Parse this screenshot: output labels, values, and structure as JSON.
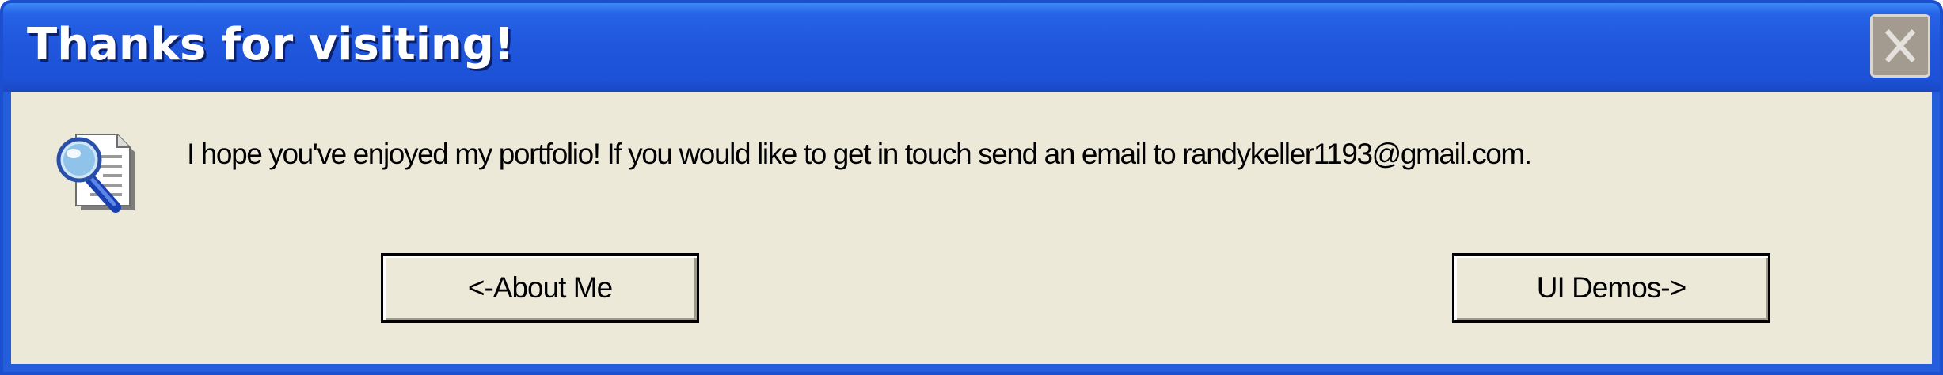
{
  "window": {
    "title": "Thanks for visiting!",
    "close_icon": "close-x-icon"
  },
  "dialog": {
    "icon": "document-magnifier-icon",
    "message": "I hope you've enjoyed my portfolio! If you would like to get in touch send an email to randykeller1193@gmail.com."
  },
  "buttons": {
    "about_label": "<-About Me",
    "demos_label": "UI Demos->"
  },
  "colors": {
    "titlebar": "#1f56dc",
    "client_bg": "#ece9d8",
    "close_button": "#a39a90"
  }
}
